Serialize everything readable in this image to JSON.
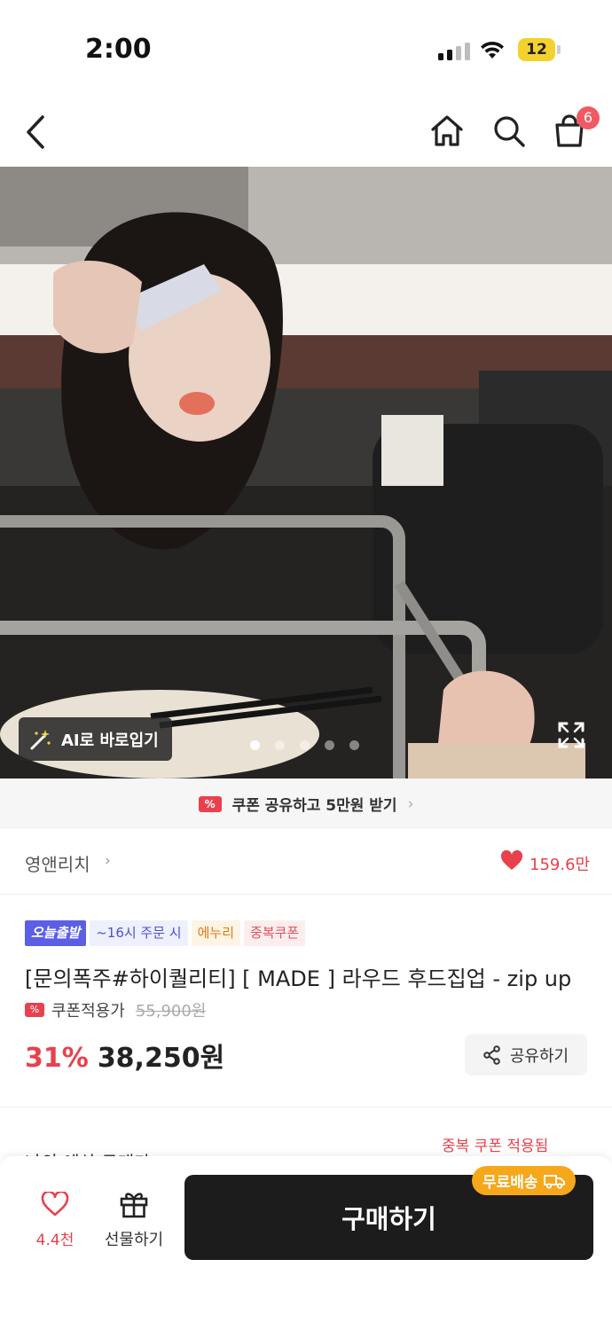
{
  "status_bar": {
    "time": "2:00",
    "battery": "12"
  },
  "nav": {
    "cart_count": "6",
    "icons": [
      "back-chevron-icon",
      "home-icon",
      "search-icon",
      "cart-icon"
    ]
  },
  "hero": {
    "ai_button": "AI로 바로입기",
    "slide_count": 5,
    "active_slide": 1
  },
  "coupon_banner": {
    "text": "쿠폰 공유하고 5만원 받기",
    "tag": "%"
  },
  "brand": {
    "name": "영앤리치",
    "likes": "159.6만"
  },
  "product": {
    "badges": [
      "오늘출발",
      "~16시 주문 시",
      "에누리",
      "중복쿠폰"
    ],
    "title": "[문의폭주#하이퀄리티] [ MADE ]  라우드 후드집업 - zip up",
    "coupon_label": "쿠폰적용가",
    "original_price": "55,900원",
    "discount": "31%",
    "price": "38,250원",
    "share_label": "공유하기"
  },
  "partial_row": {
    "label": "나의 예상 구매가",
    "stack_coupon": "중복 쿠폰 적용됨"
  },
  "bottom_bar": {
    "like_count": "4.4천",
    "gift_label": "선물하기",
    "buy_label": "구매하기",
    "free_shipping": "무료배송"
  },
  "colors": {
    "accent_red": "#e8414d",
    "buy_black": "#1c1c1c",
    "free_ship_orange": "#f6a71a",
    "badge_blue": "#5b5fe3"
  }
}
